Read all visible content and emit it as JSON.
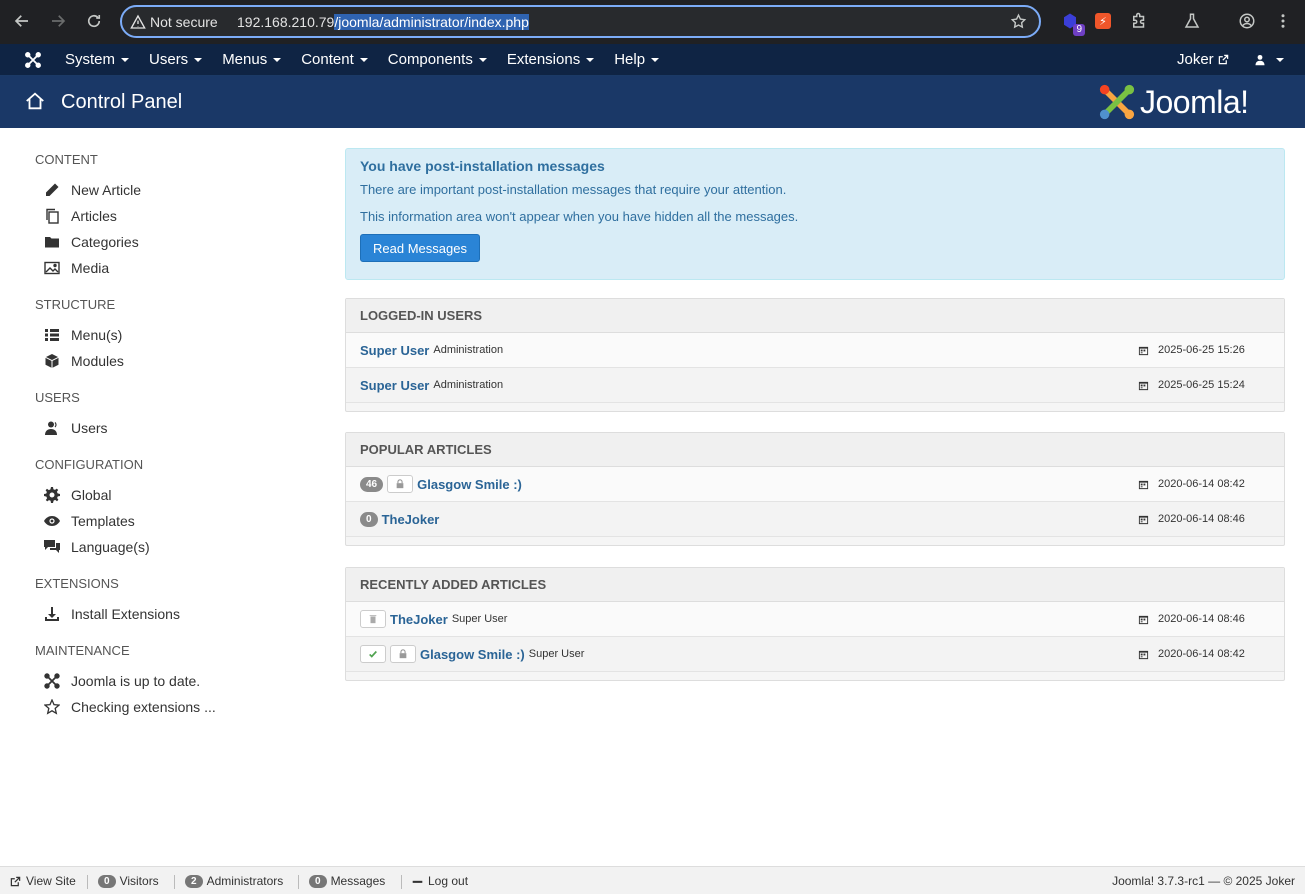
{
  "browser": {
    "security_label": "Not secure",
    "url_host": "192.168.210.79",
    "url_path": "/joomla/administrator/index.php",
    "extension_badge": "9"
  },
  "topnav": {
    "menus": [
      "System",
      "Users",
      "Menus",
      "Content",
      "Components",
      "Extensions",
      "Help"
    ],
    "user_name": "Joker"
  },
  "header": {
    "title": "Control Panel",
    "brand": "Joomla!"
  },
  "sidebar": {
    "sections": [
      {
        "heading": "CONTENT",
        "items": [
          {
            "label": "New Article",
            "icon": "pencil-icon"
          },
          {
            "label": "Articles",
            "icon": "stack-icon"
          },
          {
            "label": "Categories",
            "icon": "folder-icon"
          },
          {
            "label": "Media",
            "icon": "image-icon"
          }
        ]
      },
      {
        "heading": "STRUCTURE",
        "items": [
          {
            "label": "Menu(s)",
            "icon": "list-icon"
          },
          {
            "label": "Modules",
            "icon": "cube-icon"
          }
        ]
      },
      {
        "heading": "USERS",
        "items": [
          {
            "label": "Users",
            "icon": "users-icon"
          }
        ]
      },
      {
        "heading": "CONFIGURATION",
        "items": [
          {
            "label": "Global",
            "icon": "gear-icon"
          },
          {
            "label": "Templates",
            "icon": "eye-icon"
          },
          {
            "label": "Language(s)",
            "icon": "comments-icon"
          }
        ]
      },
      {
        "heading": "EXTENSIONS",
        "items": [
          {
            "label": "Install Extensions",
            "icon": "download-icon"
          }
        ]
      },
      {
        "heading": "MAINTENANCE",
        "items": [
          {
            "label": "Joomla is up to date.",
            "icon": "joomla-icon"
          },
          {
            "label": "Checking extensions ...",
            "icon": "star-icon"
          }
        ]
      }
    ]
  },
  "alert": {
    "title": "You have post-installation messages",
    "line1": "There are important post-installation messages that require your attention.",
    "line2": "This information area won't appear when you have hidden all the messages.",
    "button": "Read Messages"
  },
  "logged_in": {
    "heading": "LOGGED-IN USERS",
    "rows": [
      {
        "name": "Super User",
        "sub": "Administration",
        "date": "2025-06-25 15:26"
      },
      {
        "name": "Super User",
        "sub": "Administration",
        "date": "2025-06-25 15:24"
      }
    ]
  },
  "popular": {
    "heading": "POPULAR ARTICLES",
    "rows": [
      {
        "hits": "46",
        "locked": true,
        "name": "Glasgow Smile :)",
        "date": "2020-06-14 08:42"
      },
      {
        "hits": "0",
        "locked": false,
        "name": "TheJoker",
        "date": "2020-06-14 08:46"
      }
    ]
  },
  "recent": {
    "heading": "RECENTLY ADDED ARTICLES",
    "rows": [
      {
        "status": "trashed",
        "locked": false,
        "name": "TheJoker",
        "author": "Super User",
        "date": "2020-06-14 08:46"
      },
      {
        "status": "published",
        "locked": true,
        "name": "Glasgow Smile :)",
        "author": "Super User",
        "date": "2020-06-14 08:42"
      }
    ]
  },
  "statusbar": {
    "view_site": "View Site",
    "visitors_count": "0",
    "visitors_label": "Visitors",
    "admins_count": "2",
    "admins_label": "Administrators",
    "messages_count": "0",
    "messages_label": "Messages",
    "logout": "Log out",
    "version": "Joomla! 3.7.3-rc1  —  © 2025 Joker"
  },
  "colors": {
    "topnav_bg": "#0f2444",
    "header_bg": "#1a3867",
    "link": "#2a6496",
    "alert_bg": "#d9edf7"
  }
}
